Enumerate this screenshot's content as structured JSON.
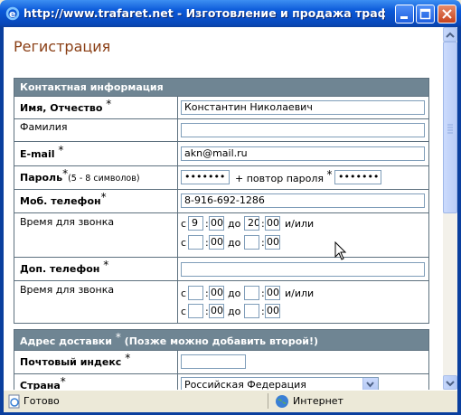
{
  "window": {
    "title": "http://www.trafaret.net - Изготовление и продажа трафарето..."
  },
  "page": {
    "heading": "Регистрация"
  },
  "contact": {
    "header": "Контактная информация",
    "name_label": "Имя, Отчество",
    "name_value": "Константин Николаевич",
    "surname_label": "Фамилия",
    "surname_value": "",
    "email_label": "E-mail",
    "email_value": "akn@mail.ru",
    "password_label": "Пароль",
    "password_hint": "(5 - 8 символов)",
    "password_value": "•••••••",
    "repeat_label": "+ повтор пароля",
    "repeat_value": "•••••••",
    "mobile_label": "Моб. телефон",
    "mobile_value": "8-916-692-1286",
    "call_time_label": "Время для звонка",
    "c": "с",
    "colon": ":",
    "to": "до",
    "or": "и/или",
    "call1": {
      "from_h": "9",
      "from_m": "00",
      "to_h": "20",
      "to_m": "00",
      "from2_h": "",
      "from2_m": "00",
      "to2_h": "",
      "to2_m": "00"
    },
    "extra_phone_label": "Доп. телефон",
    "extra_phone_value": "",
    "call_time2_label": "Время для звонка",
    "call2": {
      "from_h": "",
      "from_m": "00",
      "to_h": "",
      "to_m": "00",
      "from2_h": "",
      "from2_m": "00",
      "to2_h": "",
      "to2_m": "00"
    }
  },
  "delivery": {
    "header": "Адрес доставки",
    "header_note": "(Позже можно добавить второй!)",
    "postal_label": "Почтовый индекс",
    "postal_value": "",
    "country_label": "Страна",
    "country_value": "Российская Федерация"
  },
  "star": "*",
  "status": {
    "ready": "Готово",
    "zone": "Интернет"
  },
  "colors": {
    "heading": "#8a3e14",
    "table_header": "#6f8593",
    "title_bar": "#0a58d8"
  }
}
